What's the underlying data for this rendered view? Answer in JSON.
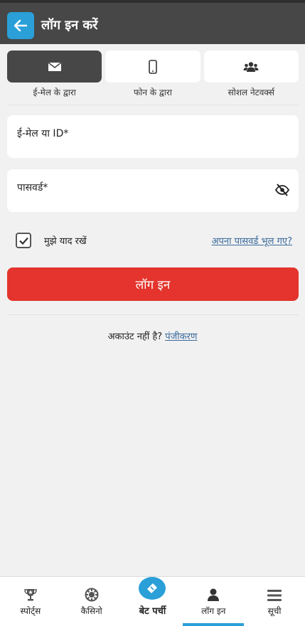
{
  "header": {
    "title": "लॉग इन करें",
    "back_icon": "arrow-left-icon"
  },
  "tabs": [
    {
      "label": "ई-मेल के द्वारा",
      "icon": "envelope-icon",
      "active": true
    },
    {
      "label": "फोन के द्वारा",
      "icon": "mobile-phone-icon",
      "active": false
    },
    {
      "label": "सोशल नेटवर्क्स",
      "icon": "users-icon",
      "active": false
    }
  ],
  "form": {
    "email_label": "ई-मेल या ID*",
    "password_label": "पासवर्ड*",
    "remember_label": "मुझे याद रखें",
    "remember_checked": true,
    "forgot_link": "अपना पासवर्ड भूल गए?",
    "submit_label": "लॉग इन"
  },
  "register": {
    "prompt": "अकाउंट नहीं है?",
    "link": "पंजीकरण"
  },
  "bottom_nav": [
    {
      "label": "स्पोर्ट्स",
      "icon": "trophy-icon"
    },
    {
      "label": "कैसिनो",
      "icon": "casino-chip-icon"
    },
    {
      "label": "बेट पर्ची",
      "icon": "ticket-icon"
    },
    {
      "label": "लॉग इन",
      "icon": "user-icon",
      "active": true
    },
    {
      "label": "सूची",
      "icon": "menu-icon"
    }
  ],
  "colors": {
    "accent": "#2a9fd8",
    "primary_button": "#e4342d",
    "header_bg": "#474747",
    "link": "#3a6a9b"
  }
}
